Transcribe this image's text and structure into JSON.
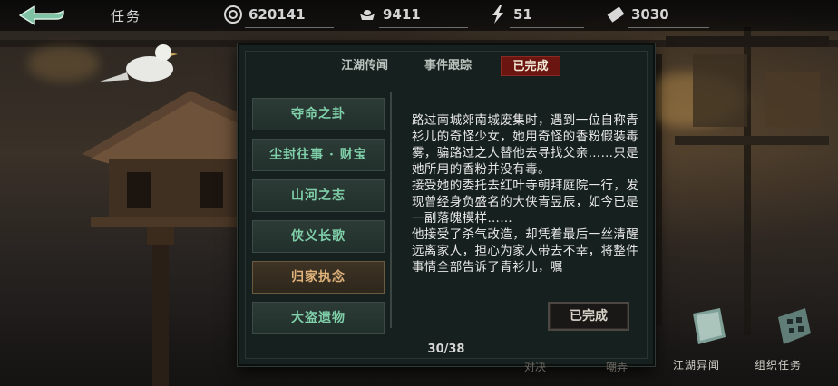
{
  "header": {
    "title": "任务",
    "back_icon": "back-arrow-icon",
    "resources": [
      {
        "icon": "coin-icon",
        "value": "620141"
      },
      {
        "icon": "ingot-icon",
        "value": "9411"
      },
      {
        "icon": "lightning-icon",
        "value": "51"
      },
      {
        "icon": "ticket-icon",
        "value": "3030"
      }
    ]
  },
  "panel": {
    "tabs": [
      {
        "label": "江湖传闻",
        "active": false
      },
      {
        "label": "事件跟踪",
        "active": false
      },
      {
        "label": "已完成",
        "active": true
      }
    ],
    "quests": [
      {
        "label": "夺命之卦",
        "selected": false
      },
      {
        "label": "尘封往事 · 财宝",
        "selected": false
      },
      {
        "label": "山河之志",
        "selected": false
      },
      {
        "label": "侠义长歌",
        "selected": false
      },
      {
        "label": "归家执念",
        "selected": true
      },
      {
        "label": "大盗遗物",
        "selected": false
      }
    ],
    "description": [
      "路过南城郊南城废集时，遇到一位自称青衫儿的奇怪少女，她用奇怪的香粉假装毒雾，骗路过之人替他去寻找父亲……只是她所用的香粉并没有毒。",
      "接受她的委托去红叶寺朝拜庭院一行，发现曾经身负盛名的大侠青昱辰，如今已是一副落魄模样……",
      "他接受了杀气改造，却凭着最后一丝清醒远离家人，担心为家人带去不幸，将整件事情全部告诉了青衫儿，嘱"
    ],
    "done_button": "已完成",
    "pager": "30/38"
  },
  "shortcuts": [
    {
      "label": "江湖异闻",
      "icon": "book-icon"
    },
    {
      "label": "组织任务",
      "icon": "scroll-icon"
    }
  ],
  "ghost_labels": [
    "对决",
    "嘲弄"
  ],
  "colors": {
    "active_tab": "#6b1511",
    "quest_text": "#7fcfa9",
    "quest_selected_text": "#e0b27a",
    "panel_bg": "#16201e"
  }
}
